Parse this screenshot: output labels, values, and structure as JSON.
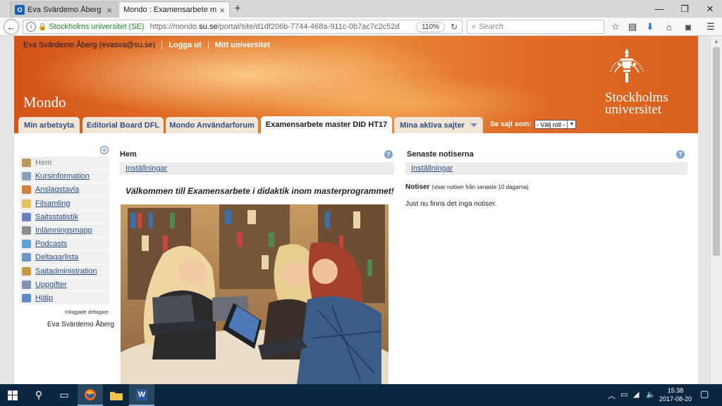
{
  "browser": {
    "tabs": [
      {
        "title": "Eva Svärdemo Åberg - Ou...",
        "favicon": "O",
        "active": false
      },
      {
        "title": "Mondo : Examensarbete mast...",
        "active": true
      }
    ],
    "new_tab": "+",
    "window_controls": {
      "minimize": "—",
      "restore": "❐",
      "close": "✕"
    },
    "identity": "Stockholms universitet (SE)",
    "url_prefix": "https://mondo.",
    "url_domain": "su.se",
    "url_path": "/portal/site/d1df206b-7744-468a-911c-0b7ac7c2c52d",
    "zoom": "110%",
    "search_placeholder": "Search"
  },
  "header": {
    "user": "Eva Svärdemo Åberg (evasva@su.se)",
    "logout": "Logga ut",
    "my_university": "Mitt universitet",
    "site_title": "Mondo",
    "logo_line1": "Stockholms",
    "logo_line2": "universitet"
  },
  "site_tabs": [
    {
      "label": "Min arbetsyta"
    },
    {
      "label": "Editorial Board DFL"
    },
    {
      "label": "Mondo Användarforum"
    },
    {
      "label": "Examensarbete master DID HT17",
      "current": true
    },
    {
      "label": "Mina aktiva sajter"
    }
  ],
  "view_as": {
    "label": "Se sajt som:",
    "value": "- Välj roll -"
  },
  "tool_menu": [
    {
      "label": "Hem",
      "icon": "home-icon",
      "color": "#b79a5c"
    },
    {
      "label": "Kursinformation",
      "icon": "document-icon",
      "color": "#8aa0bb"
    },
    {
      "label": "Anslagstavla",
      "icon": "announcement-icon",
      "color": "#d0803a"
    },
    {
      "label": "Filsamling",
      "icon": "folder-icon",
      "color": "#e8c05a"
    },
    {
      "label": "Sajtsstatistik",
      "icon": "statistics-icon",
      "color": "#6b7fc4"
    },
    {
      "label": "Inlämningsmapp",
      "icon": "dropbox-icon",
      "color": "#8d8d8d"
    },
    {
      "label": "Podcasts",
      "icon": "podcast-icon",
      "color": "#5aa3d6"
    },
    {
      "label": "Deltagarlista",
      "icon": "roster-icon",
      "color": "#6d94c9"
    },
    {
      "label": "Sajtadministration",
      "icon": "site-admin-icon",
      "color": "#c79a3f"
    },
    {
      "label": "Uppgifter",
      "icon": "assignment-icon",
      "color": "#7e94b5"
    },
    {
      "label": "Hjälp",
      "icon": "help-icon",
      "color": "#5a8cc9"
    }
  ],
  "presence": {
    "title": "Inloggade deltagare",
    "user": "Eva Svärdemo Åberg"
  },
  "home_portlet": {
    "title": "Hem",
    "settings": "Inställningar",
    "welcome": "Välkommen till Examensarbete i didaktik inom masterprogrammet!"
  },
  "news_portlet": {
    "title": "Senaste notiserna",
    "settings": "Inställningar",
    "label": "Notiser",
    "note": "(visar notiser från senaste 10 dagarna)",
    "empty": "Just nu finns det inga notiser."
  },
  "taskbar": {
    "time": "15:38",
    "date": "2017-08-20",
    "word_label": "W"
  },
  "colors": {
    "banner_orange": "#e5782b",
    "link_blue": "#2c4f86",
    "taskbar": "#0b2740"
  }
}
